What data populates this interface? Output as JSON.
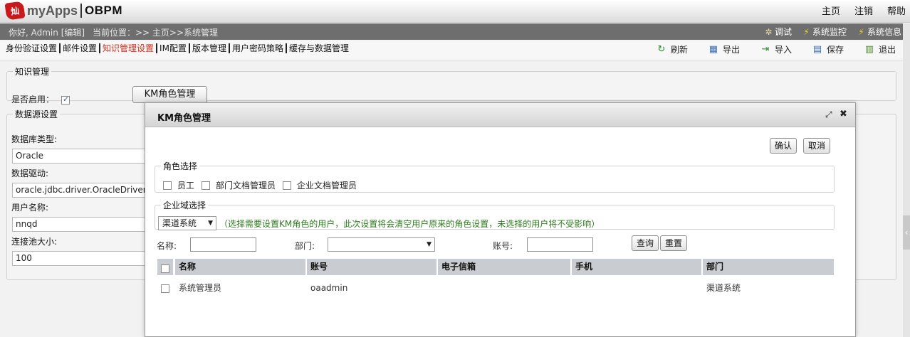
{
  "header": {
    "logo_char": "灿",
    "brand": "myApps",
    "product": "OBPM",
    "links": [
      "主页",
      "注销",
      "帮助"
    ]
  },
  "infobar": {
    "greeting": "你好, Admin [编辑]",
    "breadcrumb": "当前位置：>> 主页>>系统管理",
    "tools": [
      {
        "icon": "debug-icon",
        "label": "调试"
      },
      {
        "icon": "lightning-icon",
        "label": "系统监控"
      },
      {
        "icon": "lightning-icon",
        "label": "系统信息"
      }
    ]
  },
  "tabs": [
    "身份验证设置",
    "邮件设置",
    "知识管理设置",
    "IM配置",
    "版本管理",
    "用户密码策略",
    "缓存与数据管理"
  ],
  "active_tab": "知识管理设置",
  "toolbar": [
    {
      "icon": "refresh-icon",
      "label": "刷新"
    },
    {
      "icon": "export-icon",
      "label": "导出"
    },
    {
      "icon": "import-icon",
      "label": "导入"
    },
    {
      "icon": "save-icon",
      "label": "保存"
    },
    {
      "icon": "exit-icon",
      "label": "退出"
    }
  ],
  "km": {
    "legend": "知识管理",
    "enable_label": "是否启用：",
    "enabled": true,
    "role_button": "KM角色管理"
  },
  "datasource": {
    "legend": "数据源设置",
    "db_type_label": "数据库类型:",
    "db_type_value": "Oracle",
    "driver_label": "数据驱动:",
    "driver_value": "oracle.jdbc.driver.OracleDriver",
    "user_label": "用户名称:",
    "user_value": "nnqd",
    "pool_label": "连接池大小:",
    "pool_value": "100"
  },
  "modal": {
    "title": "KM角色管理",
    "confirm": "确认",
    "cancel": "取消",
    "role_legend": "角色选择",
    "roles": [
      "员工",
      "部门文档管理员",
      "企业文档管理员"
    ],
    "domain_legend": "企业域选择",
    "domain_value": "渠道系统",
    "domain_hint": "（选择需要设置KM角色的用户，此次设置将会清空用户原来的角色设置，未选择的用户将不受影响）",
    "filter": {
      "name_label": "名称:",
      "dept_label": "部门:",
      "account_label": "账号:",
      "query": "查询",
      "reset": "重置"
    },
    "columns": [
      "名称",
      "账号",
      "电子信箱",
      "手机",
      "部门"
    ],
    "rows": [
      {
        "name": "系统管理员",
        "account": "oaadmin",
        "email": "",
        "phone": "",
        "dept": "渠道系统"
      }
    ]
  },
  "colors": {
    "active_tab": "#d62c1a",
    "infobar_bg": "#6e6e6e",
    "hint_green": "#2e7d1e",
    "grid_header": "#c9ccd0"
  }
}
